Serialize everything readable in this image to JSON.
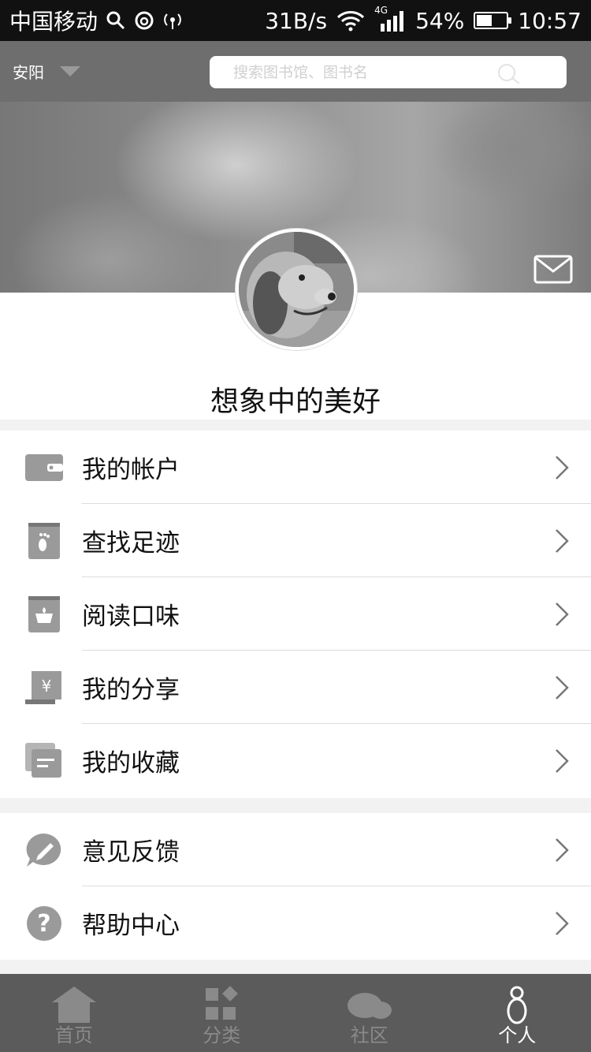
{
  "status_bar": {
    "carrier": "中国移动",
    "speed": "31B/s",
    "network": "4G",
    "battery": "54%",
    "battery_level": 0.54,
    "time": "10:57"
  },
  "top_bar": {
    "city": "安阳",
    "search_placeholder": "搜索图书馆、图书名"
  },
  "profile": {
    "username": "想象中的美好"
  },
  "menu_group_1": [
    {
      "label": "我的帐户",
      "icon": "wallet-icon"
    },
    {
      "label": "查找足迹",
      "icon": "footprint-book-icon"
    },
    {
      "label": "阅读口味",
      "icon": "taste-book-icon"
    },
    {
      "label": "我的分享",
      "icon": "yuan-scroll-icon"
    },
    {
      "label": "我的收藏",
      "icon": "collection-icon"
    }
  ],
  "menu_group_2": [
    {
      "label": "意见反馈",
      "icon": "feedback-pencil-icon"
    },
    {
      "label": "帮助中心",
      "icon": "help-question-icon"
    }
  ],
  "tab_bar": {
    "tabs": [
      {
        "label": "首页",
        "icon": "home-icon"
      },
      {
        "label": "分类",
        "icon": "category-icon"
      },
      {
        "label": "社区",
        "icon": "community-cloud-icon"
      },
      {
        "label": "个人",
        "icon": "person-icon"
      }
    ],
    "active": "个人"
  },
  "colors": {
    "status_bar_bg": "#111111",
    "top_bar_bg": "#6e6e6e",
    "tab_bar_bg": "#5b5b5b",
    "icon_gray": "#9a9a9a"
  }
}
